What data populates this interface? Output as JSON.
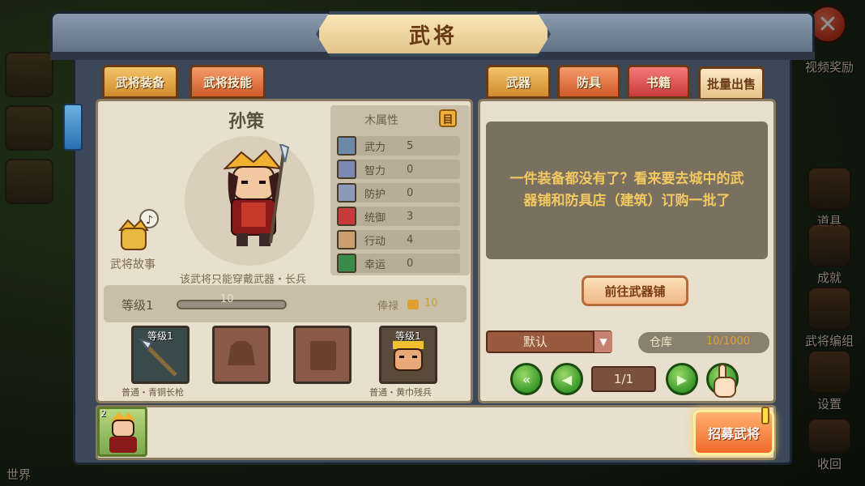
{
  "window": {
    "title": "武将"
  },
  "top_tabs_left": [
    {
      "label": "武将装备"
    },
    {
      "label": "武将技能"
    }
  ],
  "top_tabs_right": [
    {
      "label": "武器"
    },
    {
      "label": "防具"
    },
    {
      "label": "书籍"
    },
    {
      "label": "批量出售"
    }
  ],
  "hero": {
    "name": "孙策",
    "story_label": "武将故事",
    "weapon_hint": "该武将只能穿戴武器・长兵",
    "level_label": "等级1",
    "exp_text": "10",
    "exp_fill": 0.0,
    "salary_label": "俸禄",
    "salary_value": "10"
  },
  "attributes": {
    "title": "木属性",
    "detail_button": "目",
    "stats": [
      {
        "name": "武力",
        "value": "5",
        "icon": "sword-icon",
        "color": "#6a8aa8"
      },
      {
        "name": "智力",
        "value": "0",
        "icon": "scroll-icon",
        "color": "#7a8ab0"
      },
      {
        "name": "防护",
        "value": "0",
        "icon": "armor-icon",
        "color": "#8a9ab8"
      },
      {
        "name": "统御",
        "value": "3",
        "icon": "flag-icon",
        "color": "#c83a3a"
      },
      {
        "name": "行动",
        "value": "4",
        "icon": "boot-icon",
        "color": "#c8a070"
      },
      {
        "name": "幸运",
        "value": "0",
        "icon": "clover-icon",
        "color": "#3a8a4a"
      }
    ]
  },
  "equipment_slots": [
    {
      "level": "等级1",
      "name": "普通・青铜长枪",
      "type": "weapon"
    },
    {
      "level": "",
      "name": "",
      "type": "armor-empty"
    },
    {
      "level": "",
      "name": "",
      "type": "book-empty"
    },
    {
      "level": "等级1",
      "name": "普通・黄巾残兵",
      "type": "soldier"
    }
  ],
  "inventory": {
    "empty_message": "一件装备都没有了？看来要去城中的武器铺和防具店（建筑）订购一批了",
    "goto_button": "前往武器铺",
    "sort_value": "默认",
    "warehouse_label": "仓库",
    "warehouse_value": "10/1000",
    "page": "1/1"
  },
  "bottom": {
    "card_number": "2",
    "recruit_button": "招募武将"
  },
  "background_menu": {
    "right": [
      {
        "label": "视频奖励"
      },
      {
        "label": "道具"
      },
      {
        "label": "成就"
      },
      {
        "label": "武将编组"
      },
      {
        "label": "设置"
      },
      {
        "label": "收回"
      }
    ],
    "world_label": "世界"
  },
  "colors": {
    "frame": "#3c4858",
    "panel": "#e8dfcc",
    "accent_gold": "#f4c46a",
    "recruit_orange": "#f06a2a"
  }
}
